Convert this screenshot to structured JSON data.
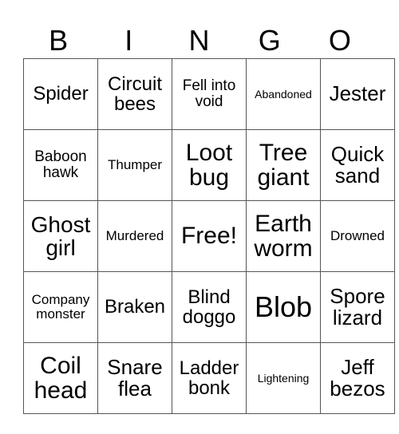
{
  "header": [
    "B",
    "I",
    "N",
    "G",
    "O"
  ],
  "grid": [
    [
      "Spider",
      "Circuit bees",
      "Fell into void",
      "Abandoned",
      "Jester"
    ],
    [
      "Baboon hawk",
      "Thumper",
      "Loot bug",
      "Tree giant",
      "Quick sand"
    ],
    [
      "Ghost girl",
      "Murdered",
      "Free!",
      "Earth worm",
      "Drowned"
    ],
    [
      "Company monster",
      "Braken",
      "Blind doggo",
      "Blob",
      "Spore lizard"
    ],
    [
      "Coil head",
      "Snare flea",
      "Ladder bonk",
      "Lightening",
      "Jeff bezos"
    ]
  ]
}
